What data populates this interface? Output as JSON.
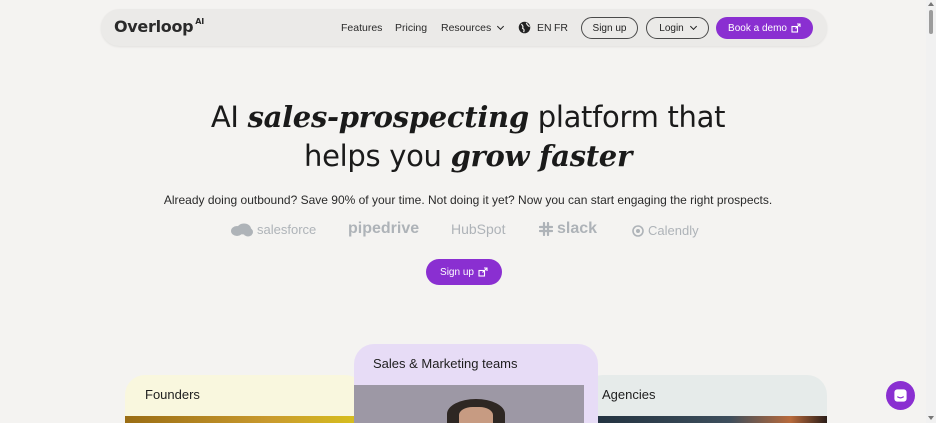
{
  "nav": {
    "logo": "Overloop",
    "logo_sup": "AI",
    "links": [
      "Features",
      "Pricing",
      "Resources"
    ],
    "lang_en": "EN",
    "lang_fr": "FR",
    "signup": "Sign up",
    "login": "Login",
    "demo": "Book a demo"
  },
  "hero": {
    "line1_a": "AI ",
    "line1_em": "sales-prospecting",
    "line1_b": " platform that",
    "line2_a": "helps you ",
    "line2_em": "grow faster",
    "subtitle": "Already doing outbound? Save 90% of your time. Not doing it yet? Now you can start engaging the right prospects.",
    "cta": "Sign up"
  },
  "integrations": [
    "salesforce",
    "pipedrive",
    "HubSpot",
    "slack",
    "Calendly"
  ],
  "cards": [
    "Founders",
    "Sales & Marketing teams",
    "Agencies"
  ],
  "colors": {
    "accent": "#8a2fd1",
    "background": "#f4f3f1",
    "logos": "#aeb3b8"
  }
}
